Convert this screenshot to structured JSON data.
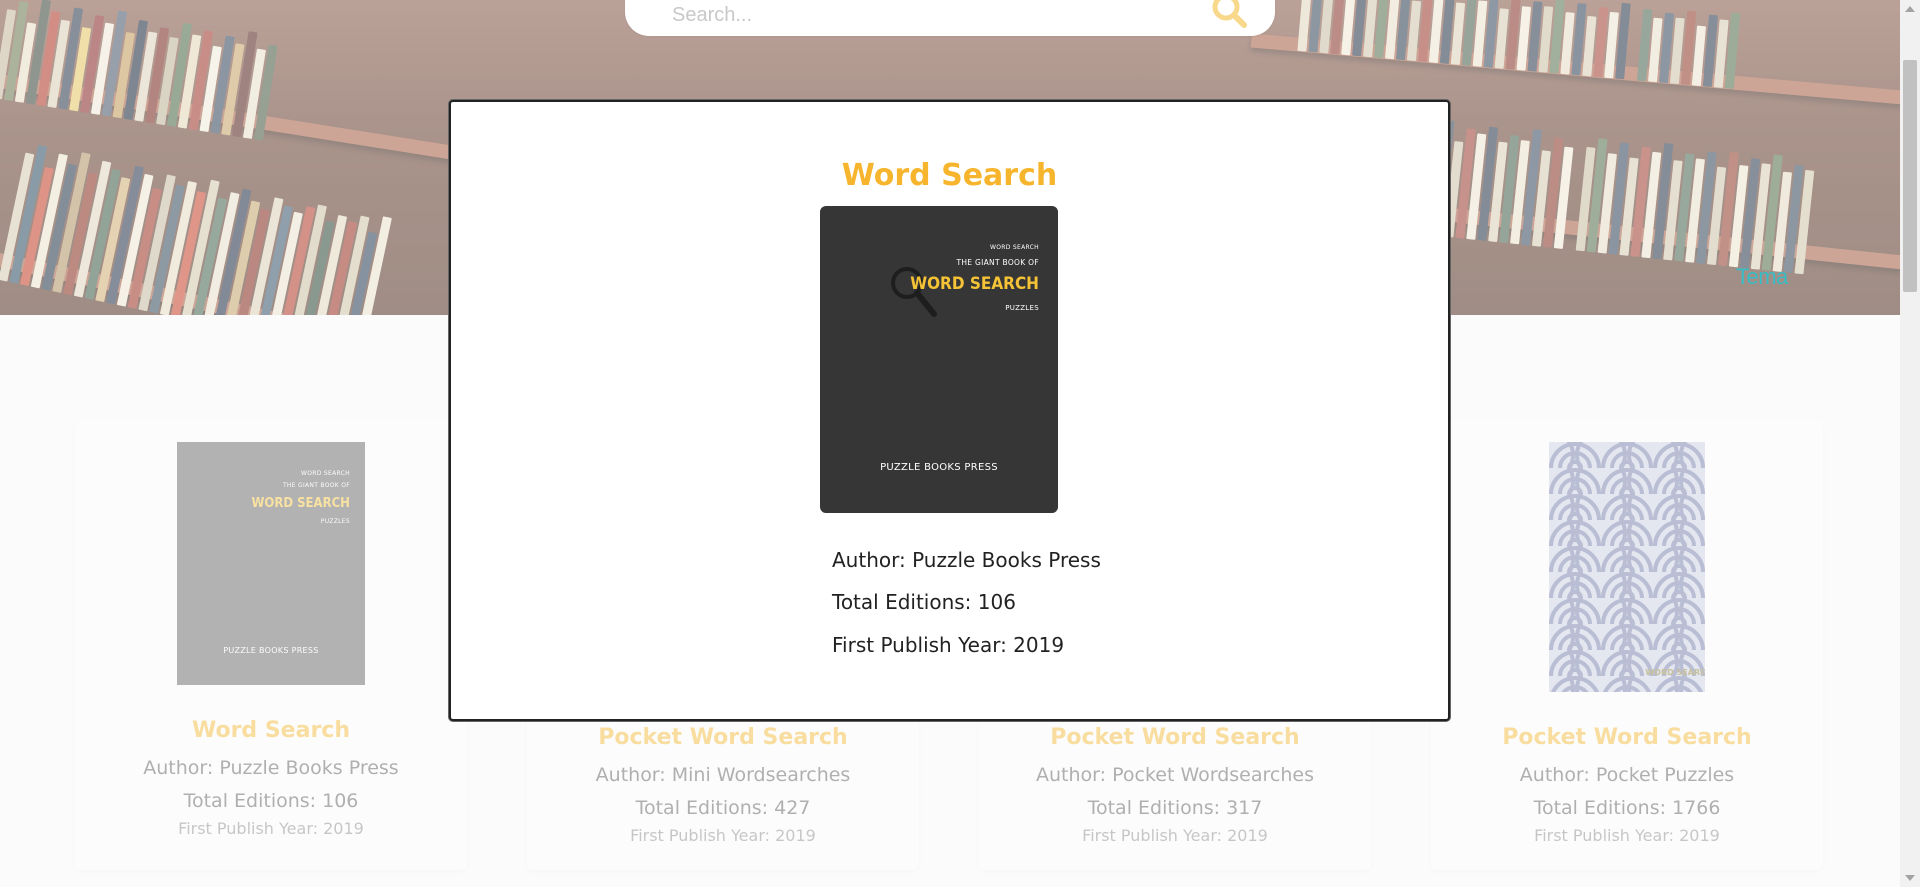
{
  "search": {
    "placeholder": "Search..."
  },
  "header": {
    "theme_label": "Tema"
  },
  "cards": [
    {
      "title": "Word Search",
      "author_label": "Author:",
      "author": "Puzzle Books Press",
      "editions_label": "Total Editions:",
      "editions": "106",
      "year_label": "First Publish Year:",
      "year": "2019",
      "cover": "giant-book-word-search"
    },
    {
      "title": "Pocket Word Search",
      "author_label": "Author:",
      "author": "Mini Wordsearches",
      "editions_label": "Total Editions:",
      "editions": "427",
      "year_label": "First Publish Year:",
      "year": "2019",
      "cover": "none-visible"
    },
    {
      "title": "Pocket Word Search",
      "author_label": "Author:",
      "author": "Pocket Wordsearches",
      "editions_label": "Total Editions:",
      "editions": "317",
      "year_label": "First Publish Year:",
      "year": "2019",
      "cover": "none-visible"
    },
    {
      "title": "Pocket Word Search",
      "author_label": "Author:",
      "author": "Pocket Puzzles",
      "editions_label": "Total Editions:",
      "editions": "1766",
      "year_label": "First Publish Year:",
      "year": "2019",
      "cover": "wave-pattern"
    }
  ],
  "modal": {
    "title": "Word Search",
    "author_line": "Author: Puzzle Books Press",
    "editions_line": "Total Editions: 106",
    "year_line": "First Publish Year: 2019",
    "cover": {
      "line1": "WORD SEARCH",
      "line2": "THE GIANT BOOK OF",
      "line3": "WORD SEARCH",
      "line4": "PUZZLES",
      "publisher": "PUZZLE BOOKS PRESS"
    }
  },
  "card4_cover_text": "WORD SEARCH",
  "colors": {
    "accent": "#f6b52d",
    "theme_link": "#1dc9d6",
    "cover_bg": "#363636"
  }
}
